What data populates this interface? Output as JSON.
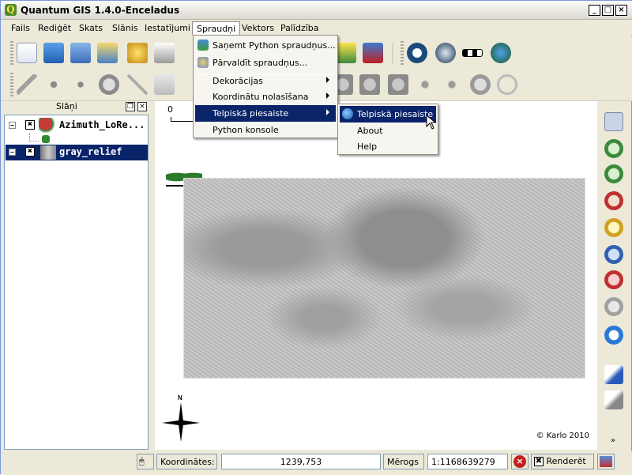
{
  "window": {
    "title": "Quantum GIS 1.4.0-Enceladus",
    "app_icon": "Q"
  },
  "menubar": [
    "Fails",
    "Rediģēt",
    "Skats",
    "Slānis",
    "Iestatījumi",
    "Spraudņi",
    "Vektors",
    "Palīdzība"
  ],
  "open_menu": "Spraudņi",
  "plugins_menu": {
    "items": [
      {
        "label": "Saņemt Python spraudņus...",
        "icon": "python-download-icon"
      },
      {
        "label": "Pārvaldīt spraudņus...",
        "icon": "plugin-manager-icon"
      },
      {
        "label": "Dekorācijas",
        "submenu": true
      },
      {
        "label": "Koordinātu nolasīšana",
        "submenu": true
      },
      {
        "label": "Telpiskā piesaiste",
        "submenu": true,
        "highlighted": true
      },
      {
        "label": "Python konsole"
      }
    ]
  },
  "submenu": {
    "items": [
      {
        "label": "Telpiskā piesaiste",
        "icon": "globe-icon",
        "highlighted": true
      },
      {
        "label": "About"
      },
      {
        "label": "Help"
      }
    ]
  },
  "layers_panel": {
    "title": "Slāņi",
    "layers": [
      {
        "name": "Azimuth_LoRe...",
        "checked": "✖",
        "expander": "−",
        "icon": "vector-layer-icon",
        "selected": false
      },
      {
        "name": "gray_relief",
        "checked": "✖",
        "expander": "−",
        "icon": "raster-layer-icon",
        "selected": true
      }
    ]
  },
  "map": {
    "scale_label": "0",
    "copyright": "© Karlo 2010",
    "north_label": "N"
  },
  "statusbar": {
    "coords_label": "Koordinātes:",
    "coords_value": "1239,753",
    "scale_label": "Mērogs",
    "scale_value": "1:1168639279",
    "render_label": "Renderēt"
  },
  "colors": {
    "highlight": "#0a246a",
    "window_bg": "#ece9d8"
  }
}
